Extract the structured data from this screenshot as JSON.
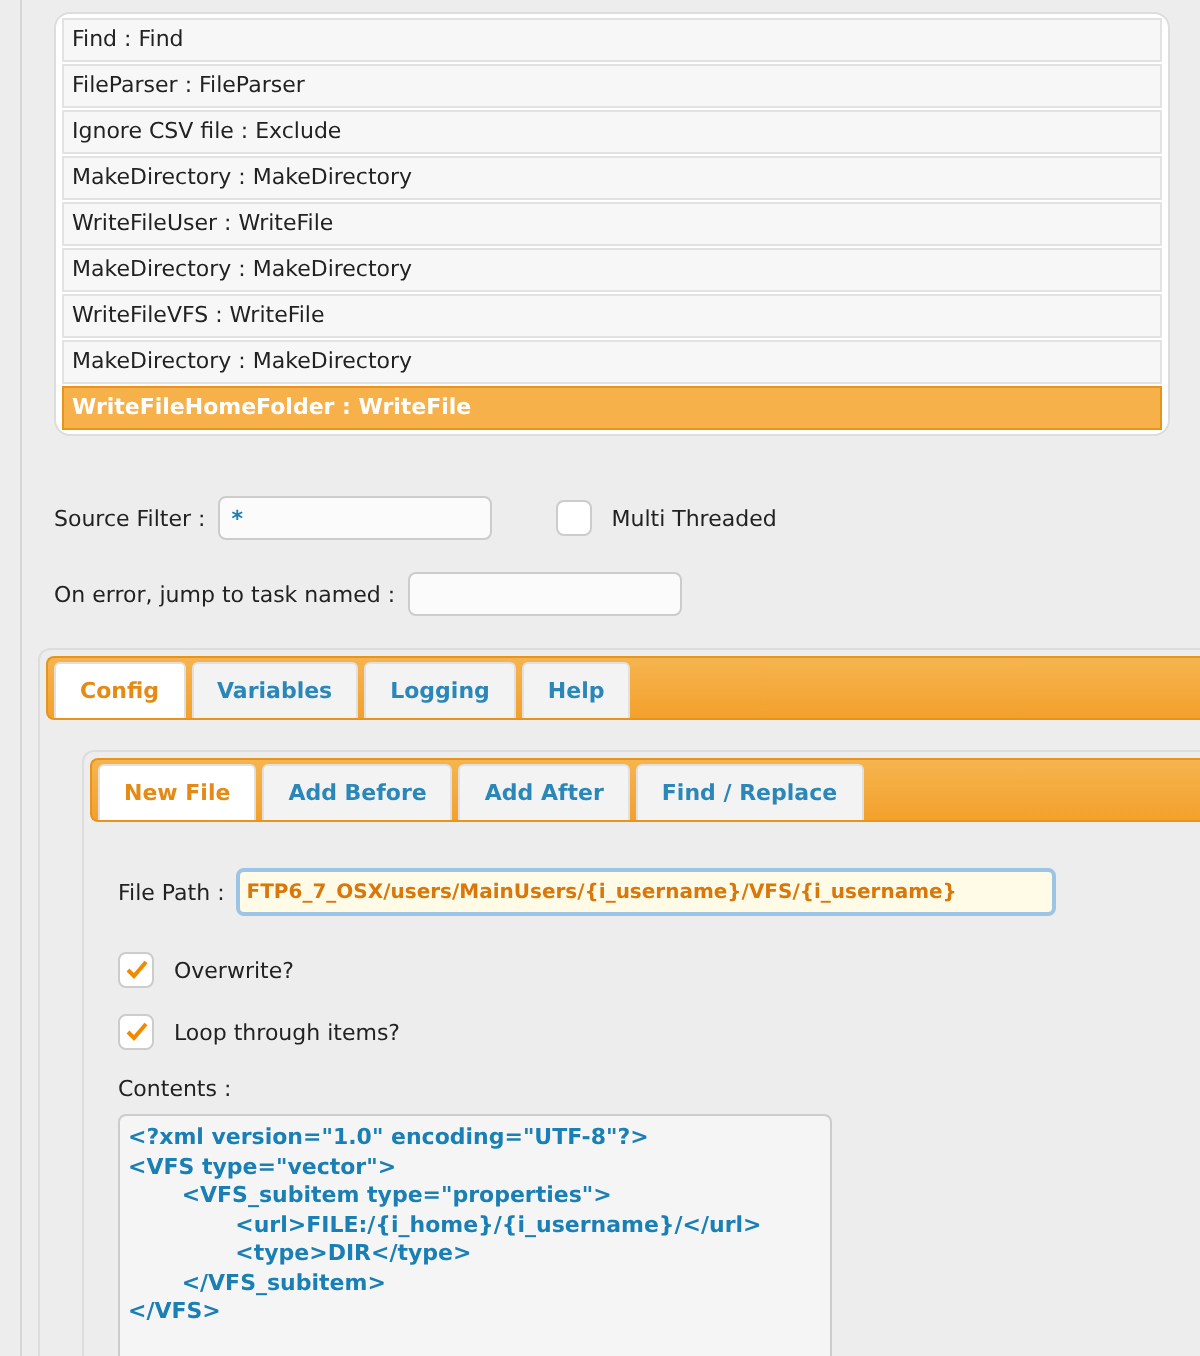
{
  "tasks": [
    {
      "label": "Find : Find",
      "selected": false
    },
    {
      "label": "FileParser : FileParser",
      "selected": false
    },
    {
      "label": "Ignore CSV file : Exclude",
      "selected": false
    },
    {
      "label": "MakeDirectory : MakeDirectory",
      "selected": false
    },
    {
      "label": "WriteFileUser : WriteFile",
      "selected": false
    },
    {
      "label": "MakeDirectory : MakeDirectory",
      "selected": false
    },
    {
      "label": "WriteFileVFS : WriteFile",
      "selected": false
    },
    {
      "label": "MakeDirectory : MakeDirectory",
      "selected": false
    },
    {
      "label": "WriteFileHomeFolder : WriteFile",
      "selected": true
    }
  ],
  "source_filter": {
    "label": "Source Filter :",
    "value": "*"
  },
  "multi_threaded": {
    "label": "Multi Threaded",
    "checked": false
  },
  "on_error": {
    "label": "On error, jump to task named :"
  },
  "tabs": [
    {
      "label": "Config",
      "selected": true
    },
    {
      "label": "Variables",
      "selected": false
    },
    {
      "label": "Logging",
      "selected": false
    },
    {
      "label": "Help",
      "selected": false
    }
  ],
  "subtabs": [
    {
      "label": "New File",
      "selected": true
    },
    {
      "label": "Add Before",
      "selected": false
    },
    {
      "label": "Add After",
      "selected": false
    },
    {
      "label": "Find / Replace",
      "selected": false
    }
  ],
  "file_path": {
    "label": "File Path :",
    "value": "FTP6_7_OSX/users/MainUsers/{i_username}/VFS/{i_username}"
  },
  "options": [
    {
      "label": "Overwrite?",
      "checked": true
    },
    {
      "label": "Loop through items?",
      "checked": true
    }
  ],
  "contents": {
    "label": "Contents :",
    "value": "<?xml version=\"1.0\" encoding=\"UTF-8\"?>\n<VFS type=\"vector\">\n\t<VFS_subitem type=\"properties\">\n\t\t<url>FILE:/{i_home}/{i_username}/</url>\n\t\t<type>DIR</type>\n\t</VFS_subitem>\n</VFS>"
  }
}
